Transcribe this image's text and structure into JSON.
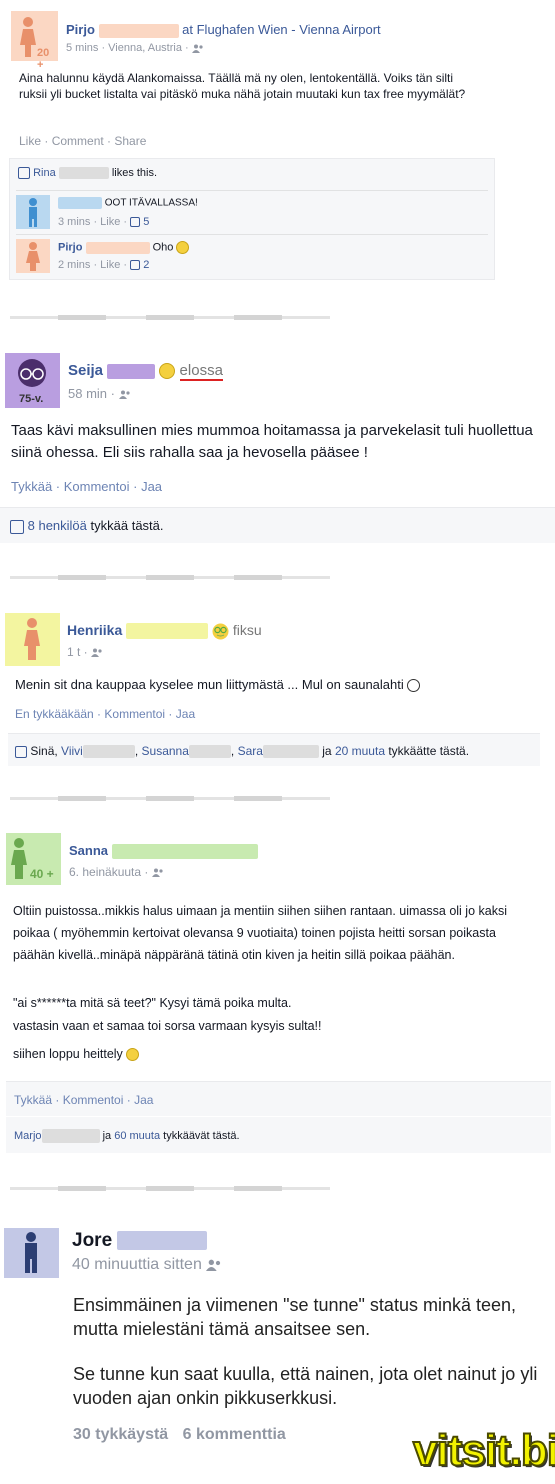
{
  "post1": {
    "name": "Pirjo",
    "at_text": "at Flughafen Wien - Vienna Airport",
    "age_badge": "20 +",
    "meta": "5 mins · Vienna, Austria ·",
    "body": "Aina halunnu käydä Alankomaissa. Täällä mä ny olen, lentokentällä. Voiks tän silti ruksii yli bucket listalta vai pitäskö muka nähä jotain muutaki kun tax free myymälät?",
    "actions": [
      "Like",
      "Comment",
      "Share"
    ],
    "likes_name": "Rina",
    "likes_suffix": "likes this.",
    "comments": [
      {
        "text": "OOT ITÄVALLASSA!",
        "meta": "3 mins · Like ·",
        "likes": "5"
      },
      {
        "name": "Pirjo",
        "text": "Oho",
        "meta": "2 mins · Like ·",
        "likes": "2"
      }
    ]
  },
  "post2": {
    "name": "Seija",
    "status": "elossa",
    "age_badge": "75-v.",
    "meta": "58 min ·",
    "body": "Taas kävi maksullinen mies mummoa hoitamassa ja parvekelasit tuli huollettua siinä ohessa. Eli siis rahalla saa ja hevosella pääsee !",
    "actions": [
      "Tykkää",
      "Kommentoi",
      "Jaa"
    ],
    "likes_link": "8 henkilöä",
    "likes_suffix": "tykkää tästä."
  },
  "post3": {
    "name": "Henriika",
    "status": "fiksu",
    "meta": "1 t ·",
    "body": "Menin sit dna kauppaa kyselee mun liittymästä ... Mul on saunalahti",
    "actions": [
      "En tykkääkään",
      "Kommentoi",
      "Jaa"
    ],
    "likes_you": "Sinä,",
    "likes_names": [
      "Viivi",
      "Susanna",
      "Sara"
    ],
    "likes_and": "ja",
    "likes_more": "20 muuta",
    "likes_suffix": "tykkäätte tästä."
  },
  "post4": {
    "name": "Sanna",
    "age_badge": "40 +",
    "meta": "6. heinäkuuta ·",
    "body1": "Oltiin puistossa..mikkis halus uimaan ja mentiin siihen siihen rantaan. uimassa oli jo kaksi poikaa ( myöhemmin kertoivat olevansa 9 vuotiaita) toinen pojista heitti sorsan poikasta päähän kivellä..minäpä näppäränä tätinä otin kiven ja heitin sillä poikaa päähän.",
    "body2": "\"ai s******ta mitä sä teet?\" Kysyi tämä poika multa.",
    "body3": "vastasin vaan et samaa toi sorsa varmaan kysyis sulta!!",
    "body4": "siihen loppu heittely",
    "actions": [
      "Tykkää",
      "Kommentoi",
      "Jaa"
    ],
    "likes_name": "Marjo",
    "likes_and": "ja",
    "likes_more": "60 muuta",
    "likes_suffix": "tykkäävät tästä."
  },
  "post5": {
    "name": "Jore",
    "meta": "40 minuuttia sitten",
    "body1": "Ensimmäinen ja viimenen \"se tunne\" status minkä teen, mutta mielestäni tämä ansaitsee sen.",
    "body2": "Se tunne kun saat kuulla, että nainen, jota olet nainut jo yli vuoden ajan onkin pikkuserkkusi.",
    "likes": "30 tykkäystä",
    "comments": "6 kommenttia"
  },
  "watermark": "vitsit.biz",
  "colors": {
    "fb_blue": "#3b5998",
    "female_pink": "#fbd7c3",
    "female_figure": "#e8906a",
    "male_blue": "#b9d8f0",
    "male_figure": "#3f8fd0",
    "lavender": "#b99ee0",
    "yellow": "#f3f5a0",
    "green": "#c8eab0",
    "jore_bg": "#c3c8e6",
    "watermark": "#f2f200"
  },
  "icons": [
    "female-figure-icon",
    "male-figure-icon",
    "friends-icon",
    "thumbs-up-icon",
    "smiley-icon",
    "glasses-emoji-icon"
  ]
}
